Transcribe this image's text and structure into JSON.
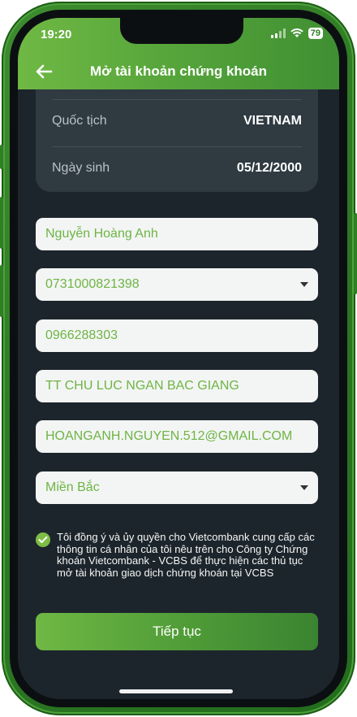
{
  "status_bar": {
    "time": "19:20",
    "battery": "79"
  },
  "header": {
    "title": "Mở tài khoản chứng khoán",
    "back_icon": "arrow-left-icon"
  },
  "info": {
    "rows": [
      {
        "label": "Quốc tịch",
        "value": "VIETNAM"
      },
      {
        "label": "Ngày sinh",
        "value": "05/12/2000"
      }
    ]
  },
  "form": {
    "full_name": "Nguyễn Hoàng Anh",
    "id_number": "0731000821398",
    "phone": "0966288303",
    "address": "TT CHU LUC NGAN BAC GIANG",
    "email": "HOANGANH.NGUYEN.512@GMAIL.COM",
    "region": "Miền Bắc"
  },
  "consent": {
    "checked": true,
    "text": "Tôi đồng ý và ủy quyền cho Vietcombank cung cấp các thông tin cá nhân của tôi nêu trên cho Công ty Chứng khoán Vietcombank - VCBS để thực hiện các thủ tục mở tài khoản giao dịch chứng khoán tại VCBS"
  },
  "actions": {
    "continue_label": "Tiếp tục"
  },
  "colors": {
    "accent": "#6eb444",
    "header_gradient_start": "#6fb844",
    "header_gradient_end": "#3f8f33",
    "background": "#1d252c"
  }
}
